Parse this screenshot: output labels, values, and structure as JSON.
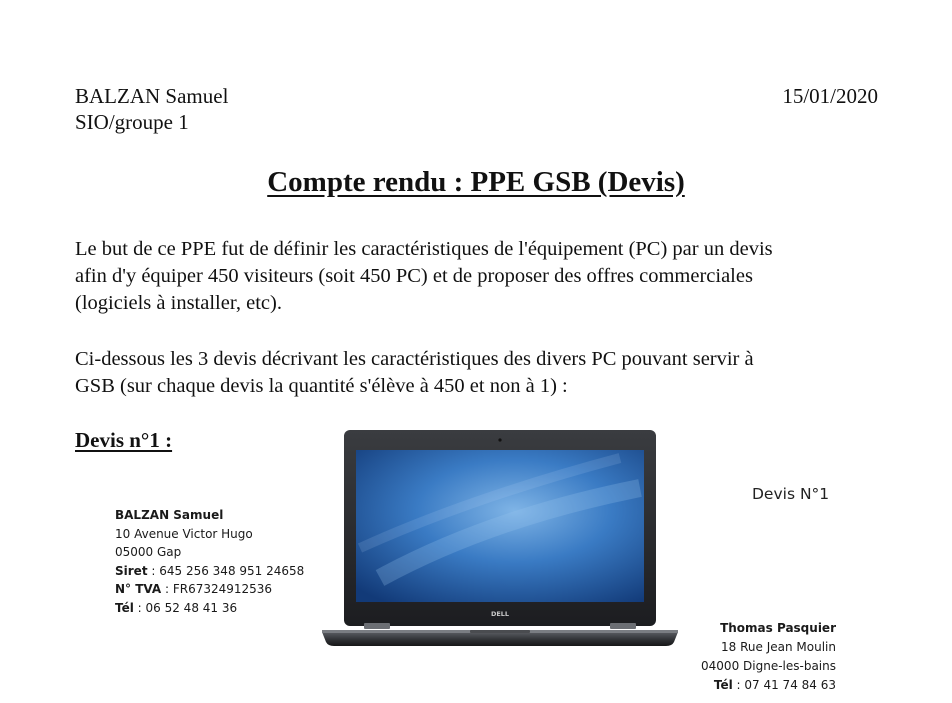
{
  "header": {
    "author": "BALZAN Samuel",
    "group": "SIO/groupe 1",
    "date": "15/01/2020"
  },
  "title": "Compte rendu : PPE GSB (Devis)",
  "intro": {
    "lines": [
      "Le but de ce PPE fut de définir les caractéristiques de l'équipement (PC) par un devis",
      "afin d'y équiper 450 visiteurs (soit 450 PC) et de proposer des offres commerciales",
      "(logiciels à installer, etc)."
    ]
  },
  "description": {
    "lines": [
      "Ci-dessous les 3 devis décrivant les caractéristiques des divers PC pouvant servir à",
      "GSB (sur chaque devis la quantité s'élève à 450 et non à 1) :"
    ]
  },
  "devis": {
    "heading": "Devis n°1 :",
    "number_label": "Devis N°1",
    "laptop_brand": "DELL",
    "sender": {
      "name": "BALZAN Samuel",
      "street": "10 Avenue Victor Hugo",
      "city": "05000 Gap",
      "siret_label": "Siret",
      "siret_value": " : 645 256 348 951 24658",
      "tva_label": "N° TVA",
      "tva_value": " : FR67324912536",
      "tel_label": "Tél",
      "tel_value": " : 06 52 48 41 36"
    },
    "recipient": {
      "name": "Thomas Pasquier",
      "street": "18 Rue Jean Moulin",
      "city": "04000 Digne-les-bains",
      "tel_label": "Tél",
      "tel_value": " : 07 41 74 84 63"
    }
  }
}
